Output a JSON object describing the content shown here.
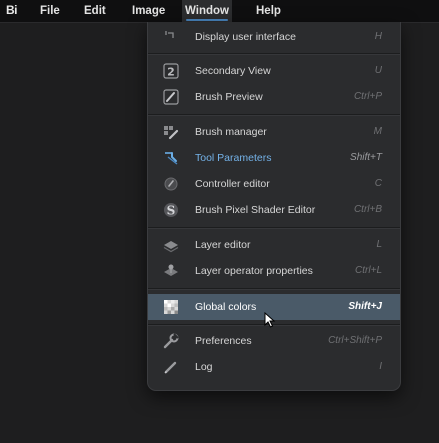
{
  "menubar": {
    "logo": "Bi",
    "items": [
      {
        "label": "File"
      },
      {
        "label": "Edit"
      },
      {
        "label": "Image"
      },
      {
        "label": "Window"
      },
      {
        "label": "Help"
      }
    ]
  },
  "window_menu": {
    "items": [
      {
        "label": "Display user interface",
        "shortcut": "H",
        "icon": "display-ui-icon"
      },
      {
        "label": "Secondary View",
        "shortcut": "U",
        "icon": "secondary-view-icon"
      },
      {
        "label": "Brush Preview",
        "shortcut": "Ctrl+P",
        "icon": "brush-preview-icon"
      },
      {
        "label": "Brush manager",
        "shortcut": "M",
        "icon": "brush-manager-icon"
      },
      {
        "label": "Tool Parameters",
        "shortcut": "Shift+T",
        "icon": "tool-parameters-icon"
      },
      {
        "label": "Controller editor",
        "shortcut": "C",
        "icon": "controller-editor-icon"
      },
      {
        "label": "Brush Pixel Shader Editor",
        "shortcut": "Ctrl+B",
        "icon": "pixel-shader-icon"
      },
      {
        "label": "Layer editor",
        "shortcut": "L",
        "icon": "layer-editor-icon"
      },
      {
        "label": "Layer operator properties",
        "shortcut": "Ctrl+L",
        "icon": "layer-operator-icon"
      },
      {
        "label": "Global colors",
        "shortcut": "Shift+J",
        "icon": "global-colors-icon"
      },
      {
        "label": "Preferences",
        "shortcut": "Ctrl+Shift+P",
        "icon": "preferences-icon"
      },
      {
        "label": "Log",
        "shortcut": "I",
        "icon": "log-icon"
      }
    ],
    "selected_item": "Global colors"
  },
  "colors": {
    "menubar_bg": "#0f0f10",
    "menu_bg": "#2b2c2e",
    "accent_text": "#74b2e8",
    "selection_bg": "#4a5a68",
    "active_tab_underline": "#4a87c0"
  }
}
